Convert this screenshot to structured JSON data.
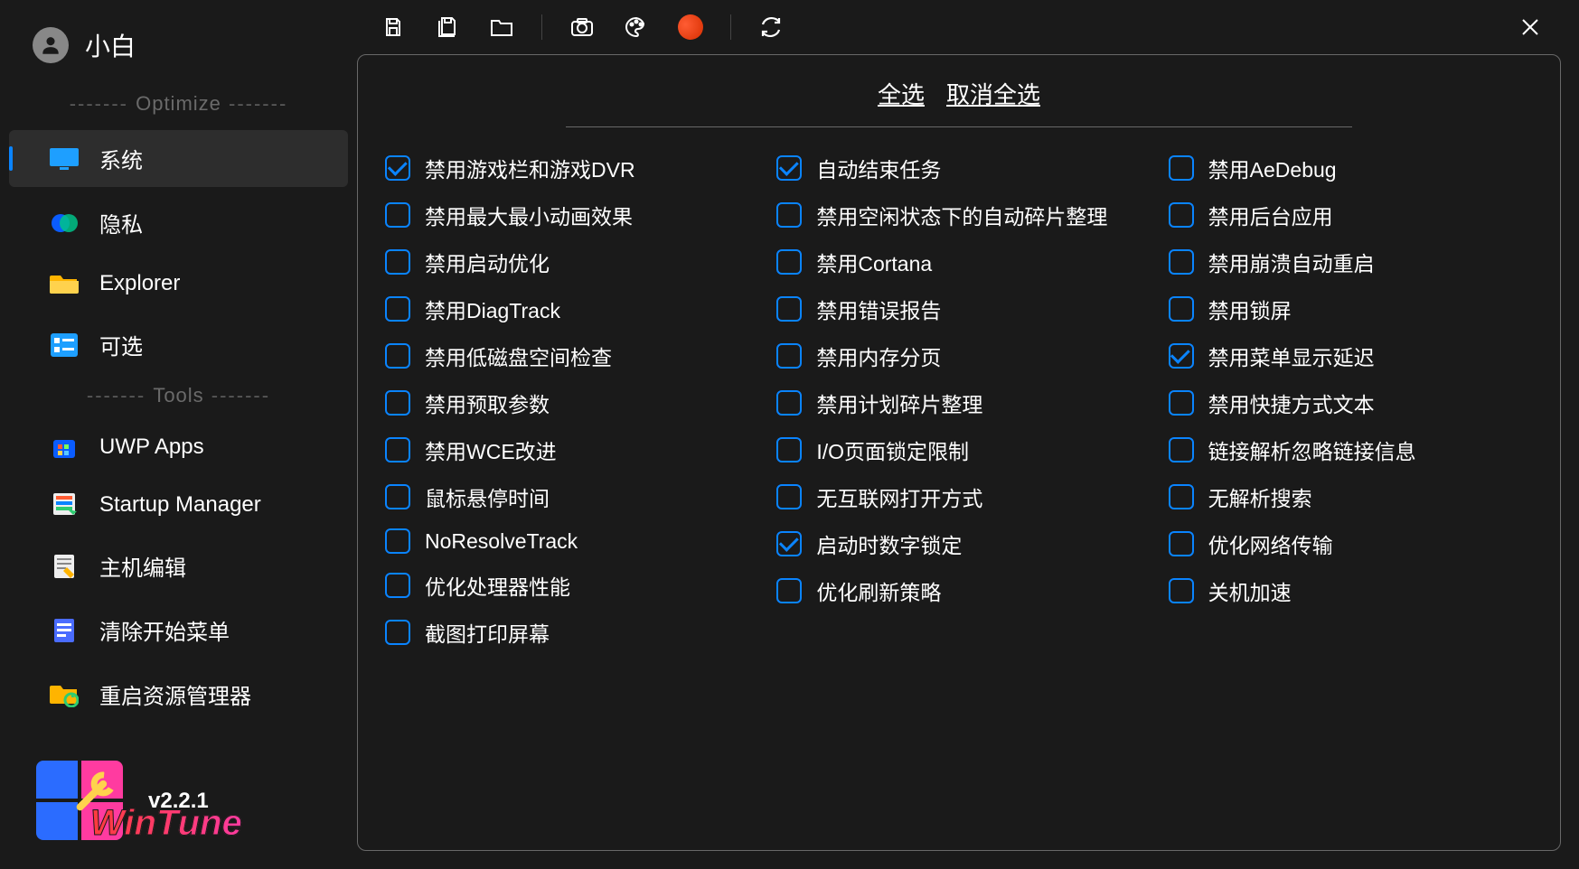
{
  "user": {
    "name": "小白"
  },
  "sections": {
    "optimize": "Optimize",
    "tools": "Tools"
  },
  "nav": {
    "system": "系统",
    "privacy": "隐私",
    "explorer": "Explorer",
    "optional": "可选",
    "uwp": "UWP Apps",
    "startup": "Startup Manager",
    "hostedit": "主机编辑",
    "clearstart": "清除开始菜单",
    "restartexp": "重启资源管理器"
  },
  "footer": {
    "version": "v2.2.1",
    "brand": "WinTune"
  },
  "actions": {
    "selectAll": "全选",
    "deselectAll": "取消全选"
  },
  "options": {
    "col1": [
      {
        "label": "禁用游戏栏和游戏DVR",
        "checked": true
      },
      {
        "label": "禁用最大最小动画效果",
        "checked": false
      },
      {
        "label": "禁用启动优化",
        "checked": false
      },
      {
        "label": "禁用DiagTrack",
        "checked": false
      },
      {
        "label": "禁用低磁盘空间检查",
        "checked": false
      },
      {
        "label": "禁用预取参数",
        "checked": false
      },
      {
        "label": "禁用WCE改进",
        "checked": false
      },
      {
        "label": "鼠标悬停时间",
        "checked": false
      },
      {
        "label": "NoResolveTrack",
        "checked": false
      },
      {
        "label": "优化处理器性能",
        "checked": false
      },
      {
        "label": "截图打印屏幕",
        "checked": false
      }
    ],
    "col2": [
      {
        "label": "自动结束任务",
        "checked": true
      },
      {
        "label": "禁用空闲状态下的自动碎片整理",
        "checked": false
      },
      {
        "label": "禁用Cortana",
        "checked": false
      },
      {
        "label": "禁用错误报告",
        "checked": false
      },
      {
        "label": "禁用内存分页",
        "checked": false
      },
      {
        "label": "禁用计划碎片整理",
        "checked": false
      },
      {
        "label": "I/O页面锁定限制",
        "checked": false
      },
      {
        "label": "无互联网打开方式",
        "checked": false
      },
      {
        "label": "启动时数字锁定",
        "checked": true
      },
      {
        "label": "优化刷新策略",
        "checked": false
      }
    ],
    "col3": [
      {
        "label": "禁用AeDebug",
        "checked": false
      },
      {
        "label": "禁用后台应用",
        "checked": false
      },
      {
        "label": "禁用崩溃自动重启",
        "checked": false
      },
      {
        "label": "禁用锁屏",
        "checked": false
      },
      {
        "label": "禁用菜单显示延迟",
        "checked": true
      },
      {
        "label": "禁用快捷方式文本",
        "checked": false
      },
      {
        "label": "链接解析忽略链接信息",
        "checked": false
      },
      {
        "label": "无解析搜索",
        "checked": false
      },
      {
        "label": "优化网络传输",
        "checked": false
      },
      {
        "label": "关机加速",
        "checked": false
      }
    ]
  }
}
